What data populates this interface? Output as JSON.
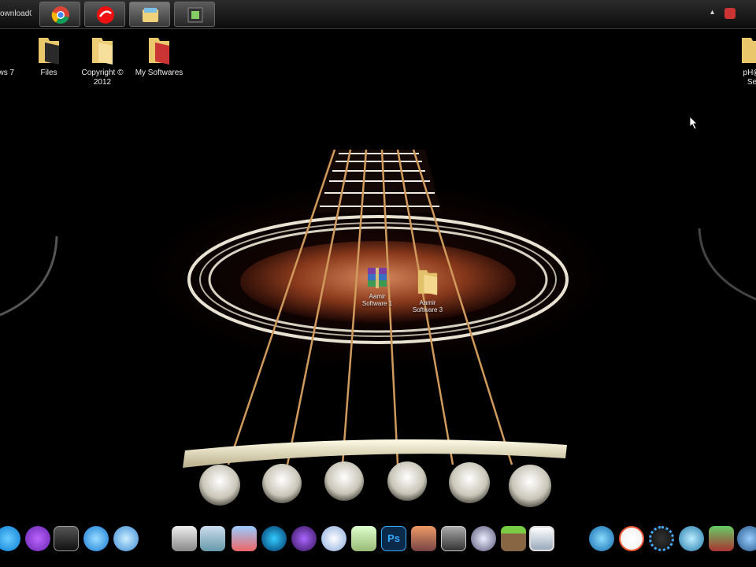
{
  "taskbar": {
    "window_title": "ownload06_",
    "buttons": [
      {
        "name": "chrome"
      },
      {
        "name": "antivirus"
      },
      {
        "name": "file-explorer"
      },
      {
        "name": "media-app"
      }
    ]
  },
  "desktop_icons": {
    "top_left": [
      {
        "label": "ows 7"
      },
      {
        "label": "Files"
      },
      {
        "label": "Copyright ©\n2012"
      },
      {
        "label": "My Softwares"
      }
    ],
    "top_right": [
      {
        "label": "pH@\nSe"
      }
    ],
    "center": [
      {
        "label": "Aamir\nSoftware 1"
      },
      {
        "label": "Aamir\nSoftware 3"
      }
    ]
  },
  "dock_icons": [
    "skype",
    "yahoo-messenger",
    "blackberry",
    "quicktime",
    "itunes",
    "camera",
    "network",
    "paint",
    "media-center",
    "infinity",
    "media-player",
    "notes",
    "photoshop",
    "mail",
    "mobile",
    "settings",
    "minecraft",
    "tablet",
    "sync",
    "fast-downloader",
    "gear",
    "internet",
    "video",
    "film"
  ]
}
